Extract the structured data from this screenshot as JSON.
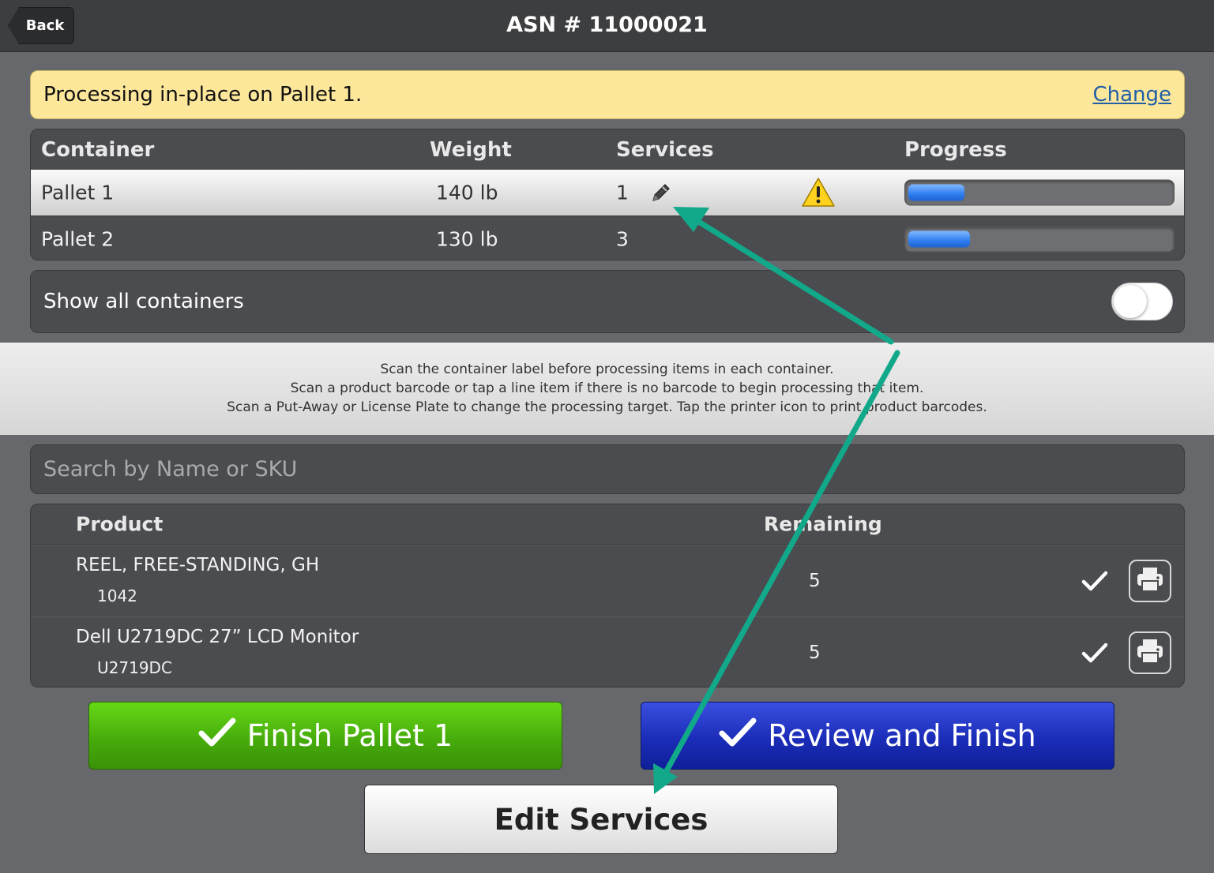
{
  "header": {
    "back_label": "Back",
    "title": "ASN # 11000021"
  },
  "banner": {
    "text": "Processing in-place on Pallet 1.",
    "link": "Change",
    "background": "#fde79a"
  },
  "containers": {
    "headers": {
      "container": "Container",
      "weight": "Weight",
      "services": "Services",
      "progress": "Progress"
    },
    "rows": [
      {
        "name": "Pallet 1",
        "weight": "140 lb",
        "services": "1",
        "has_edit_icon": true,
        "has_warning_icon": true,
        "progress": 0.22,
        "selected": true
      },
      {
        "name": "Pallet 2",
        "weight": "130 lb",
        "services": "3",
        "has_edit_icon": false,
        "has_warning_icon": false,
        "progress": 0.24,
        "selected": false
      }
    ]
  },
  "show_all": {
    "label": "Show all containers",
    "value": false
  },
  "instructions": [
    "Scan the container label before processing items in each container.",
    "Scan a product barcode or tap a line item if there is no barcode to begin processing that item.",
    "Scan a Put-Away or License Plate to change the processing target. Tap the printer icon to print product barcodes."
  ],
  "search": {
    "placeholder": "Search by Name or SKU",
    "value": ""
  },
  "products": {
    "headers": {
      "product": "Product",
      "remaining": "Remaining"
    },
    "rows": [
      {
        "name": "REEL, FREE-STANDING, GH",
        "sku": "1042",
        "remaining": "5",
        "icons": [
          "check-icon",
          "printer-icon"
        ]
      },
      {
        "name": "Dell U2719DC 27” LCD Monitor",
        "sku": "U2719DC",
        "remaining": "5",
        "icons": [
          "check-icon",
          "printer-icon"
        ]
      }
    ]
  },
  "actions": {
    "finish_label": "Finish Pallet 1",
    "review_label": "Review and Finish",
    "edit_services_label": "Edit Services"
  },
  "colors": {
    "accent_green": "#45a90a",
    "accent_blue": "#1b2db8",
    "annotation_arrow": "#12a88a",
    "progress_fill": "#2f7df0"
  }
}
